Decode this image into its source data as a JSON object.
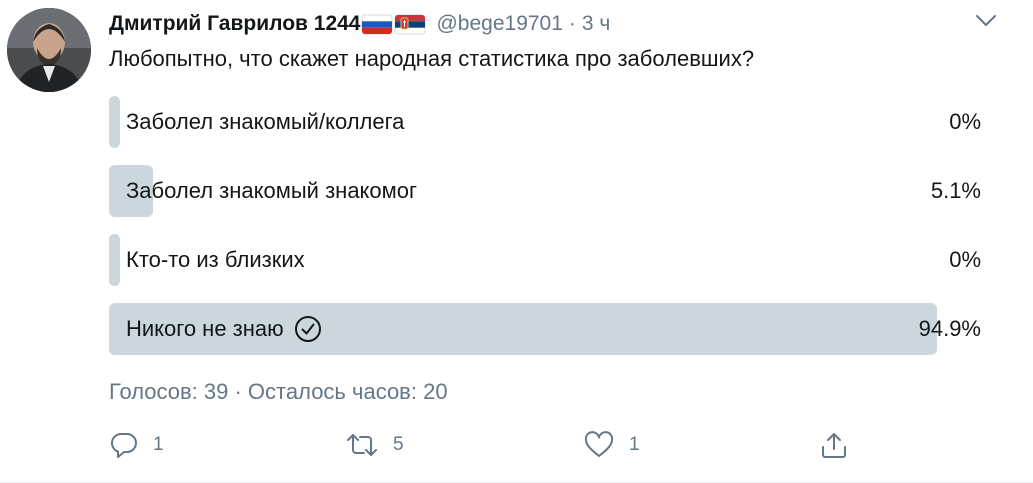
{
  "tweet": {
    "author": {
      "display_name": "Дмитрий Гаврилов 1244",
      "handle": "@bege19701",
      "flags": [
        "russia-flag",
        "serbia-flag"
      ]
    },
    "time_separator": "·",
    "time": "3 ч",
    "text": "Любопытно, что скажет народная статистика про заболевших?"
  },
  "poll": {
    "options": [
      {
        "label": "Заболел знакомый/коллега",
        "percent_text": "0%",
        "percent": 0,
        "selected": false
      },
      {
        "label": "Заболел знакомый знакомог",
        "percent_text": "5.1%",
        "percent": 5.1,
        "selected": false
      },
      {
        "label": "Кто-то из близких",
        "percent_text": "0%",
        "percent": 0,
        "selected": false
      },
      {
        "label": "Никого не знаю",
        "percent_text": "94.9%",
        "percent": 94.9,
        "selected": true
      }
    ],
    "meta": "Голосов: 39 · Осталось часов: 20"
  },
  "actions": {
    "reply_count": "1",
    "retweet_count": "5",
    "like_count": "1"
  },
  "colors": {
    "text": "#14171a",
    "secondary": "#657786",
    "poll_bar": "#ccd6dd"
  }
}
